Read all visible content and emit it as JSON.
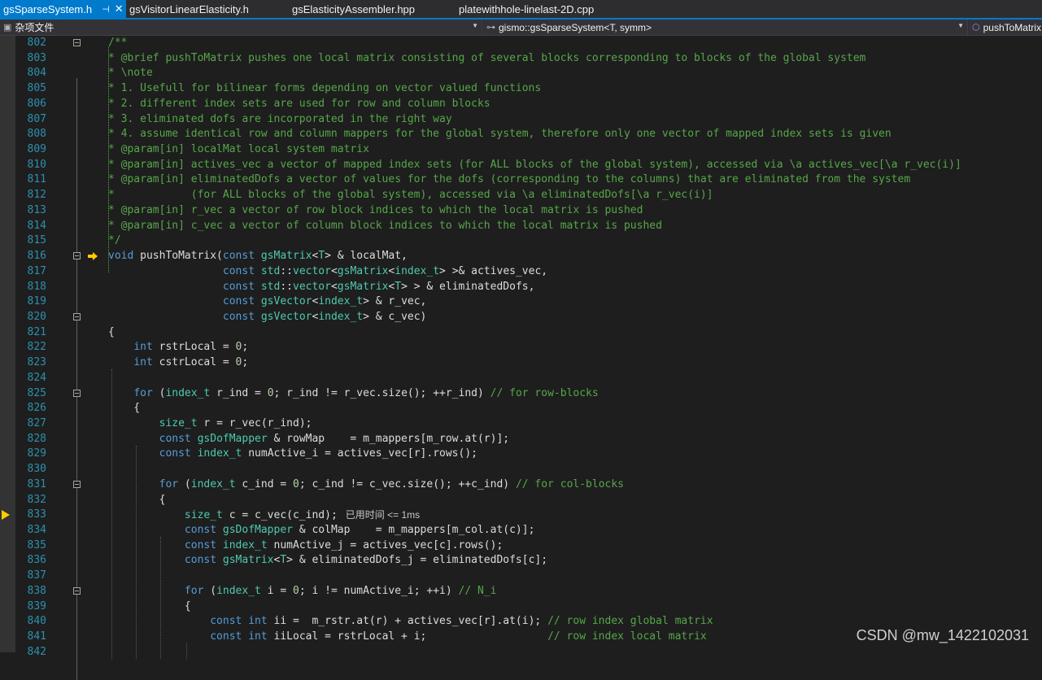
{
  "tabs": [
    {
      "label": "gsSparseSystem.h",
      "active": true,
      "pin": "⊣",
      "close": "✕"
    },
    {
      "label": "gsVisitorLinearElasticity.h",
      "active": false
    },
    {
      "label": "gsElasticityAssembler.hpp",
      "active": false
    },
    {
      "label": "platewithhole-linelast-2D.cpp",
      "active": false
    }
  ],
  "navbar": {
    "project": "杂项文件",
    "scope": "gismo::gsSparseSystem<T, symm>",
    "member": "pushToMatrix"
  },
  "lines": [
    {
      "n": "802",
      "code": "/**"
    },
    {
      "n": "803",
      "code": "* @brief pushToMatrix pushes one local matrix consisting of several blocks corresponding to blocks of the global system"
    },
    {
      "n": "804",
      "code": "* \\note"
    },
    {
      "n": "805",
      "code": "* 1. Usefull for bilinear forms depending on vector valued functions"
    },
    {
      "n": "806",
      "code": "* 2. different index sets are used for row and column blocks"
    },
    {
      "n": "807",
      "code": "* 3. eliminated dofs are incorporated in the right way"
    },
    {
      "n": "808",
      "code": "* 4. assume identical row and column mappers for the global system, therefore only one vector of mapped index sets is given"
    },
    {
      "n": "809",
      "code": "* @param[in] localMat local system matrix"
    },
    {
      "n": "810",
      "code": "* @param[in] actives_vec a vector of mapped index sets (for ALL blocks of the global system), accessed via \\a actives_vec[\\a r_vec(i)]"
    },
    {
      "n": "811",
      "code": "* @param[in] eliminatedDofs a vector of values for the dofs (corresponding to the columns) that are eliminated from the system"
    },
    {
      "n": "812",
      "code": "*            (for ALL blocks of the global system), accessed via \\a eliminatedDofs[\\a r_vec(i)]"
    },
    {
      "n": "813",
      "code": "* @param[in] r_vec a vector of row block indices to which the local matrix is pushed"
    },
    {
      "n": "814",
      "code": "* @param[in] c_vec a vector of column block indices to which the local matrix is pushed"
    },
    {
      "n": "815",
      "code": "*/"
    },
    {
      "n": "816",
      "code": "void pushToMatrix(const gsMatrix<T> & localMat,"
    },
    {
      "n": "817",
      "code": "                  const std::vector<gsMatrix<index_t> >& actives_vec,"
    },
    {
      "n": "818",
      "code": "                  const std::vector<gsMatrix<T> > & eliminatedDofs,"
    },
    {
      "n": "819",
      "code": "                  const gsVector<index_t> & r_vec,"
    },
    {
      "n": "820",
      "code": "                  const gsVector<index_t> & c_vec)"
    },
    {
      "n": "821",
      "code": "{"
    },
    {
      "n": "822",
      "code": "    int rstrLocal = 0;"
    },
    {
      "n": "823",
      "code": "    int cstrLocal = 0;"
    },
    {
      "n": "824",
      "code": ""
    },
    {
      "n": "825",
      "code": "    for (index_t r_ind = 0; r_ind != r_vec.size(); ++r_ind) // for row-blocks"
    },
    {
      "n": "826",
      "code": "    {"
    },
    {
      "n": "827",
      "code": "        size_t r = r_vec(r_ind);"
    },
    {
      "n": "828",
      "code": "        const gsDofMapper & rowMap    = m_mappers[m_row.at(r)];"
    },
    {
      "n": "829",
      "code": "        const index_t numActive_i = actives_vec[r].rows();"
    },
    {
      "n": "830",
      "code": ""
    },
    {
      "n": "831",
      "code": "        for (index_t c_ind = 0; c_ind != c_vec.size(); ++c_ind) // for col-blocks"
    },
    {
      "n": "832",
      "code": "        {"
    },
    {
      "n": "833",
      "code": "            size_t c = c_vec(c_ind);",
      "hint": "已用时间 <= 1ms"
    },
    {
      "n": "834",
      "code": "            const gsDofMapper & colMap    = m_mappers[m_col.at(c)];"
    },
    {
      "n": "835",
      "code": "            const index_t numActive_j = actives_vec[c].rows();"
    },
    {
      "n": "836",
      "code": "            const gsMatrix<T> & eliminatedDofs_j = eliminatedDofs[c];"
    },
    {
      "n": "837",
      "code": ""
    },
    {
      "n": "838",
      "code": "            for (index_t i = 0; i != numActive_i; ++i) // N_i"
    },
    {
      "n": "839",
      "code": "            {"
    },
    {
      "n": "840",
      "code": "                const int ii =  m_rstr.at(r) + actives_vec[r].at(i); // row index global matrix"
    },
    {
      "n": "841",
      "code": "                const int iiLocal = rstrLocal + i;                   // row index local matrix"
    },
    {
      "n": "842",
      "code": ""
    }
  ],
  "watermark": "CSDN @mw_1422102031",
  "colors": {
    "accent": "#007acc",
    "keyword": "#569cd6",
    "comment": "#57a64a",
    "type": "#4ec9b0",
    "line_number": "#2b91af"
  }
}
